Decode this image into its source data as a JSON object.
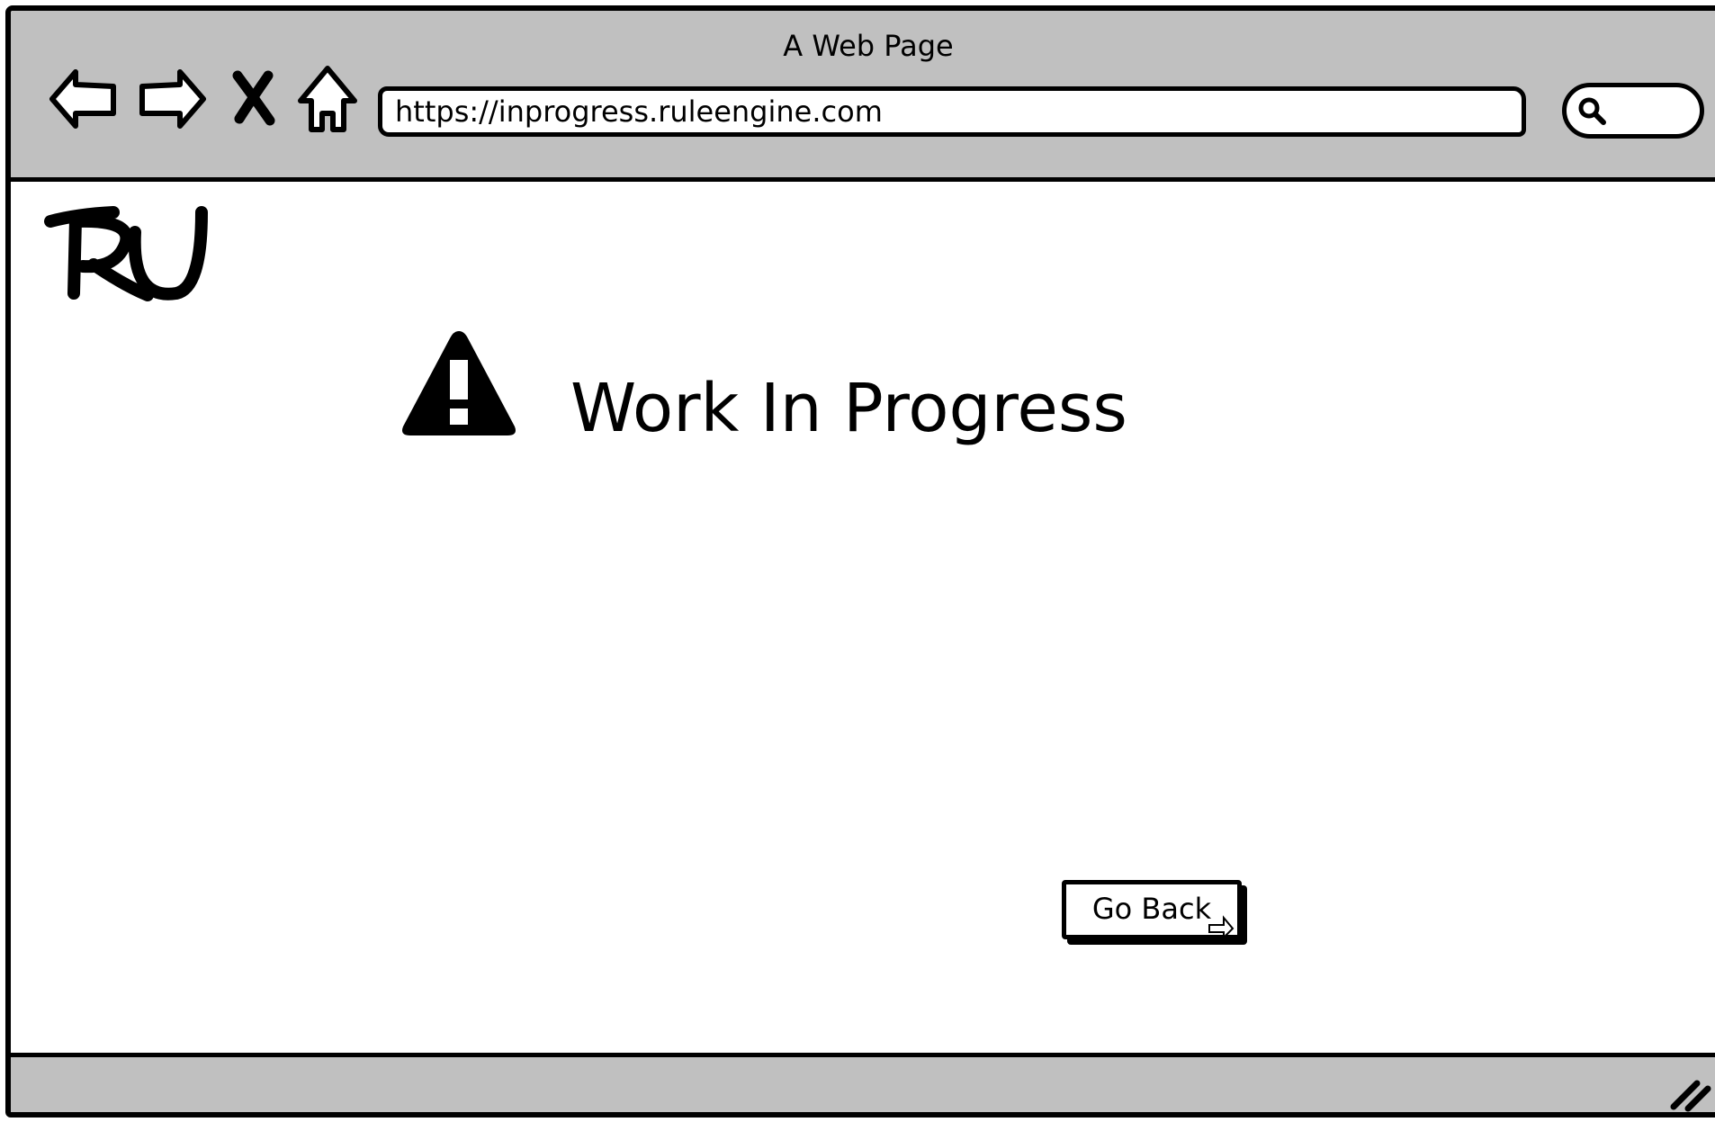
{
  "window": {
    "title": "A Web Page"
  },
  "toolbar": {
    "back_icon": "arrow-left-icon",
    "forward_icon": "arrow-right-icon",
    "stop_icon": "close-icon",
    "home_icon": "home-icon",
    "url": "https://inprogress.ruleengine.com",
    "search_icon": "search-icon",
    "search_value": ""
  },
  "page": {
    "logo_text": "RU",
    "warning_icon": "warning-icon",
    "heading": "Work In Progress",
    "back_button_label": "Go Back"
  },
  "status_bar": {
    "resize_icon": "resize-grip-icon"
  },
  "colors": {
    "chrome": "#c0c0c0",
    "background": "#ffffff",
    "ink": "#000000"
  }
}
